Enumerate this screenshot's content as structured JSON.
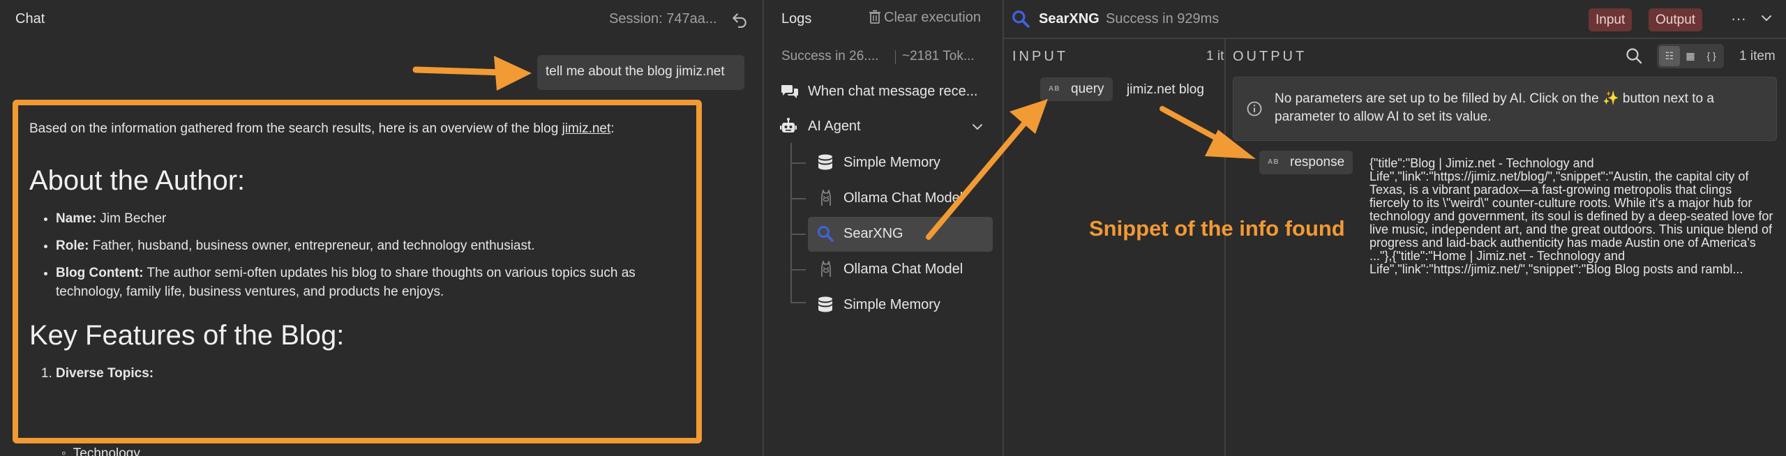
{
  "chat": {
    "title": "Chat",
    "session": "Session: 747aa...",
    "user_message": "tell me about the blog jimiz.net",
    "ai": {
      "intro_prefix": "Based on the information gathered from the search results, here is an overview of the blog ",
      "intro_link": "jimiz.net",
      "intro_suffix": ":",
      "heading1": "About the Author:",
      "bullets": [
        {
          "label": "Name:",
          "text": " Jim Becher"
        },
        {
          "label": "Role:",
          "text": " Father, husband, business owner, entrepreneur, and technology enthusiast."
        },
        {
          "label": "Blog Content:",
          "text": " The author semi-often updates his blog to share thoughts on various topics such as technology, family life, business ventures, and products he enjoys."
        }
      ],
      "heading2": "Key Features of the Blog:",
      "numbered": [
        {
          "label": "Diverse Topics:"
        }
      ],
      "sub_bullet": "Technology"
    }
  },
  "logs": {
    "title": "Logs",
    "clear_label": "Clear execution",
    "status": "Success in 26....",
    "tokens": "~2181 Tok...",
    "items": [
      {
        "label": "When chat message rece...",
        "icon": "chat-bubbles-icon"
      },
      {
        "label": "AI Agent",
        "icon": "robot-icon"
      },
      {
        "label": "Simple Memory",
        "icon": "database-icon"
      },
      {
        "label": "Ollama Chat Model",
        "icon": "llama-icon"
      },
      {
        "label": "SearXNG",
        "icon": "search-icon"
      },
      {
        "label": "Ollama Chat Model",
        "icon": "llama-icon"
      },
      {
        "label": "Simple Memory",
        "icon": "database-icon"
      }
    ]
  },
  "node": {
    "name": "SearXNG",
    "status": "Success in 929ms",
    "input_button": "Input",
    "output_button": "Output",
    "input_label": "INPUT",
    "input_count": "1 it",
    "output_label": "OUTPUT",
    "item_count": "1 item",
    "input_param": {
      "tag": "AB",
      "name": "query",
      "value": "jimiz.net blog"
    },
    "info_text": "No parameters are set up to be filled by AI. Click on the ✨ button next to a parameter to allow AI to set its value.",
    "output_param": {
      "tag": "AB",
      "name": "response"
    },
    "response_value": "{\"title\":\"Blog | Jimiz.net - Technology and Life\",\"link\":\"https://jimiz.net/blog/\",\"snippet\":\"Austin, the capital city of Texas, is a vibrant paradox—a fast-growing metropolis that clings fiercely to its \\\"weird\\\" counter-culture roots. While it's a major hub for technology and government, its soul is defined by a deep-seated love for live music, independent art, and the great outdoors. This unique blend of progress and laid-back authenticity has made Austin one of America's ...\"},{\"title\":\"Home | Jimiz.net - Technology and Life\",\"link\":\"https://jimiz.net/\",\"snippet\":\"Blog Blog posts and rambl...",
    "annotation": "Snippet of the info found"
  },
  "colors": {
    "accent": "#f29a34",
    "background": "#2b2b2b",
    "selected": "#464646",
    "io_button": "#6b3535",
    "searx_blue": "#3f63e0"
  }
}
